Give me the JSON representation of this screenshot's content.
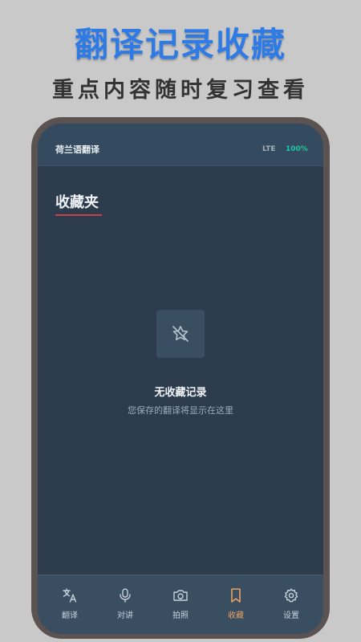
{
  "promo": {
    "headline": "翻译记录收藏",
    "subheadline": "重点内容随时复习查看"
  },
  "status": {
    "app_title": "荷兰语翻译",
    "network": "LTE",
    "battery": "100%"
  },
  "page": {
    "section_title": "收藏夹"
  },
  "empty_state": {
    "icon": "bookmark-off-icon",
    "title": "无收藏记录",
    "subtitle": "您保存的翻译将显示在这里"
  },
  "tabs": [
    {
      "label": "翻译",
      "icon": "translate-icon",
      "active": false
    },
    {
      "label": "对讲",
      "icon": "microphone-icon",
      "active": false
    },
    {
      "label": "拍照",
      "icon": "camera-icon",
      "active": false
    },
    {
      "label": "收藏",
      "icon": "bookmark-icon",
      "active": true
    },
    {
      "label": "设置",
      "icon": "gear-icon",
      "active": false
    }
  ],
  "colors": {
    "accent": "#e8a060",
    "headline": "#2f7be6",
    "underline": "#c9404a",
    "battery": "#20c5a4"
  }
}
